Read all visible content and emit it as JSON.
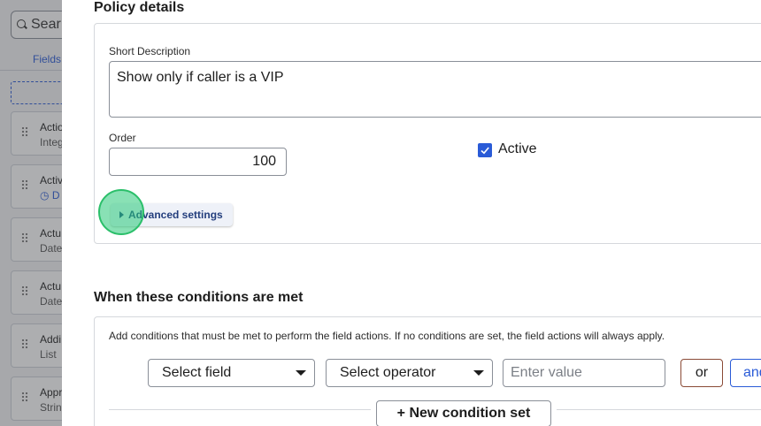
{
  "background": {
    "search_text": "Sear",
    "tab_label": "Fields",
    "cards": [
      {
        "line1": "Actio",
        "line2": "Integ",
        "line2_icon": ""
      },
      {
        "line1": "Activ",
        "line2": "D",
        "line2_icon": "clock-icon"
      },
      {
        "line1": "Actu",
        "line2": "Date",
        "line2_icon": ""
      },
      {
        "line1": "Actu",
        "line2": "Date",
        "line2_icon": ""
      },
      {
        "line1": "Addi",
        "line2": "List",
        "line2_icon": ""
      },
      {
        "line1": "Appr",
        "line2": "Strin",
        "line2_icon": ""
      }
    ]
  },
  "policy": {
    "section_title": "Policy details",
    "short_description_label": "Short Description",
    "short_description_value": "Show only if caller is a VIP",
    "order_label": "Order",
    "order_value": "100",
    "active_label": "Active",
    "active_checked": true,
    "advanced_settings_label": "Advanced settings"
  },
  "conditions": {
    "section_title": "When these conditions are met",
    "description": "Add conditions that must be met to perform the field actions. If no conditions are set, the field actions will always apply.",
    "field_select": "Select field",
    "operator_select": "Select operator",
    "value_placeholder": "Enter value",
    "or_label": "or",
    "and_label": "and",
    "new_condition_set_label": "+ New condition set"
  },
  "colors": {
    "accent_blue": "#2a5bd7",
    "highlight_green": "#2bbf6a",
    "or_border": "#8a4a36"
  }
}
